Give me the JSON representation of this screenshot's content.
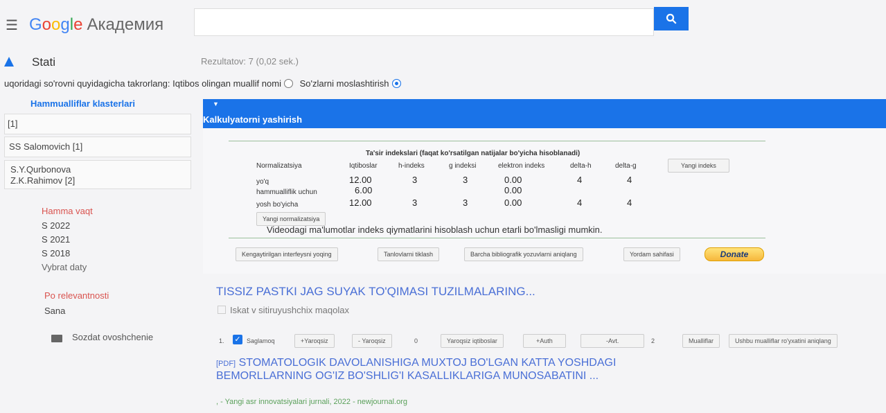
{
  "header": {
    "logo_google_parts": [
      "G",
      "o",
      "o",
      "g",
      "l",
      "e"
    ],
    "logo_suffix": "Академия",
    "search_placeholder": ""
  },
  "section": {
    "label": "Stati",
    "results": "Rezultatov: 7 (0,02 sek.)"
  },
  "repeat": {
    "text": "uqoridagi so'rovni quyidagicha takrorlang:",
    "option1": "Iqtibos olingan muallif nomi",
    "option2": "So'zlarni moslashtirish"
  },
  "clusters": {
    "title": "Hammualliflar klasterlari",
    "items": [
      "[1]",
      "SS Salomovich [1]"
    ],
    "multi_line1": "S.Y.Qurbonova",
    "multi_line2": "Z.K.Rahimov [2]"
  },
  "filters": {
    "time_title": "Hamma vaqt",
    "years": [
      "S 2022",
      "S 2021",
      "S 2018"
    ],
    "choose_date": "Vybrat daty",
    "sort_title": "Po relevantnosti",
    "sort_date": "Sana",
    "alert": "Sozdat ovoshchenie"
  },
  "calculator": {
    "toggle_label": "Kalkulyatorni yashirish",
    "table_caption": "Ta'sir indekslari (faqat ko'rsatilgan natijalar bo'yicha hisoblanadi)",
    "columns": [
      "Normalizatsiya",
      "Iqtiboslar",
      "h-indeks",
      "g indeksi",
      "elektron indeks",
      "delta-h",
      "delta-g"
    ],
    "new_index_button": "Yangi indeks",
    "rows": [
      {
        "name": "yo'q",
        "cit": "12.00",
        "h": "3",
        "g": "3",
        "e": "0.00",
        "dh": "4",
        "dg": "4"
      },
      {
        "name": "hammualliflik uchun",
        "cit": "6.00",
        "h": "",
        "g": "",
        "e": "0.00",
        "dh": "",
        "dg": ""
      },
      {
        "name": "yosh bo'yicha",
        "cit": "12.00",
        "h": "3",
        "g": "3",
        "e": "0.00",
        "dh": "4",
        "dg": "4"
      }
    ],
    "new_norm_button": "Yangi normalizatsiya",
    "notice": "Videodagi ma'lumotlar indeks qiymatlarini hisoblash uchun etarli bo'lmasligi mumkin.",
    "buttons": [
      "Kengaytirilgan interfeysni yoqing",
      "Tanlovlarni tiklash",
      "Barcha bibliografik yozuvlarni aniqlang",
      "Yordam sahifasi"
    ],
    "donate": "Donate"
  },
  "result1": {
    "title": "TISSIZ PASTKI JAG SUYAK TO'QIMASI TUZILMALARING...",
    "iskat": "Iskat v sitiruyushchix maqolax",
    "toolbar": {
      "num": "1.",
      "saglamoq": "Saglamoq",
      "plus_yaroqsiz": "+Yaroqsiz",
      "minus_yaroqsiz": "- Yaroqsiz",
      "zero": "0",
      "yaroqsiz_iqtiboslar": "Yaroqsiz iqtiboslar",
      "plus_auth": "+Auth",
      "minus_avt": "-Avt.",
      "two": "2",
      "mualliflar": "Mualliflar",
      "ushbu": "Ushbu mualliflar ro'yxatini aniqlang"
    }
  },
  "result2": {
    "pdf_tag": "[PDF]",
    "title": "STOMATOLOGIK DAVOLANISHIGA MUXTOJ BO'LGAN KATTA YOSHDAGI BEMORLLARNING OG'IZ BO'SHLIG'I KASALLIKLARIGA MUNOSABATINI ...",
    "journal": ", - Yangi asr innovatsiyalari jurnali, 2022 - newjournal.org"
  }
}
